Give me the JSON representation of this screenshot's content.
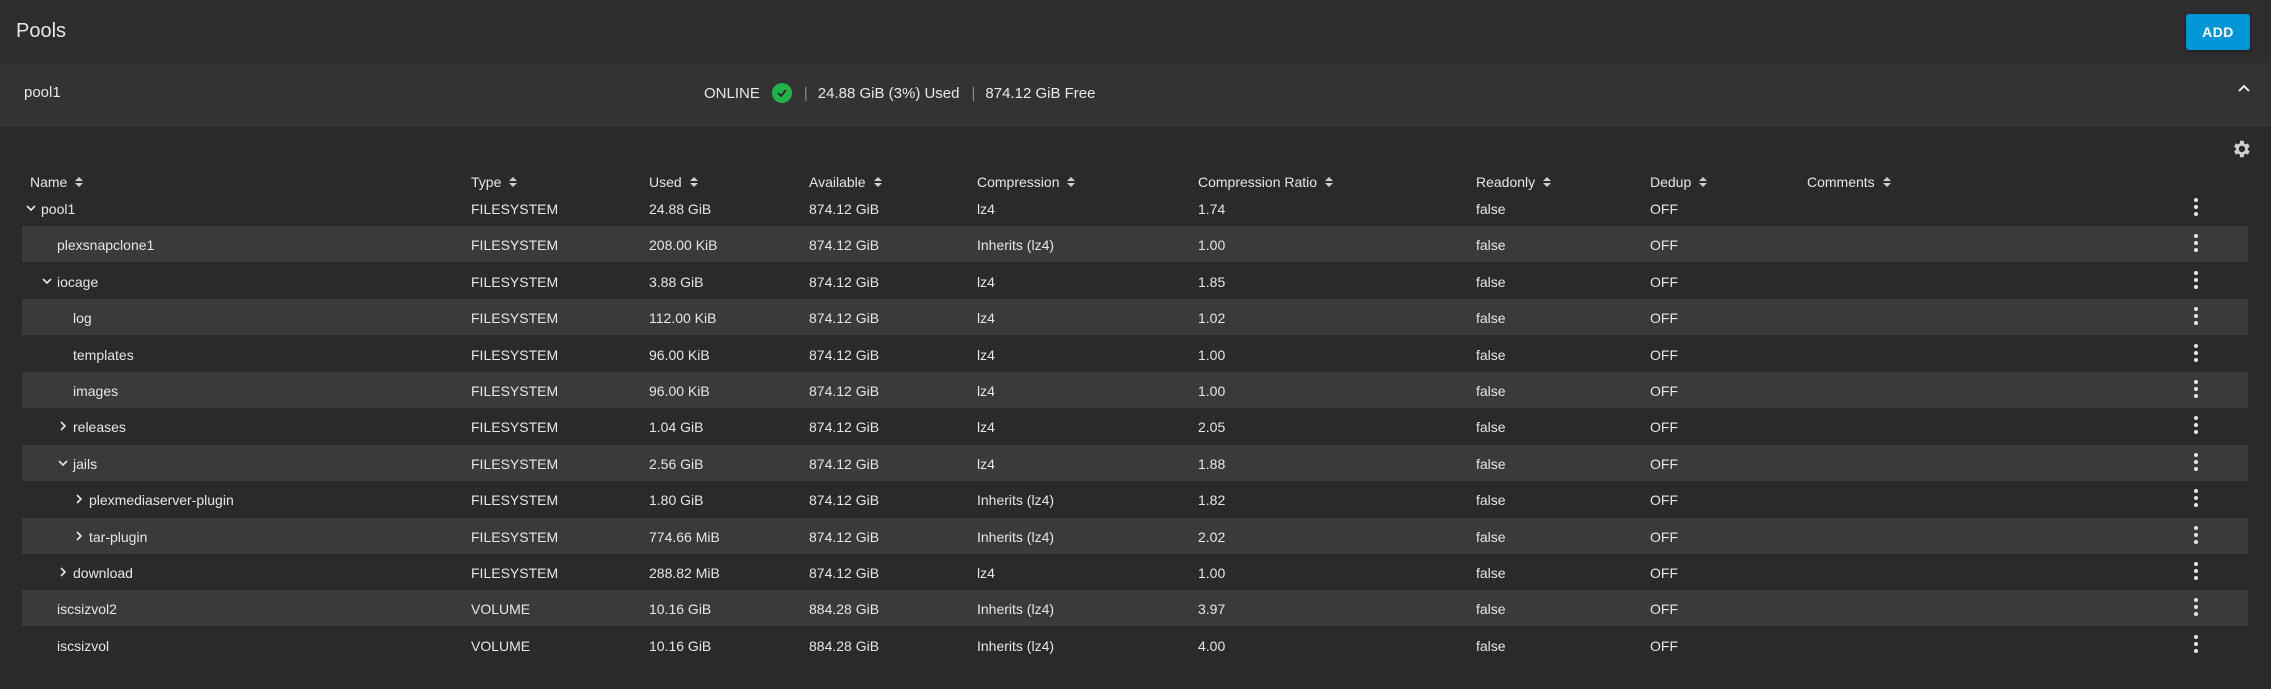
{
  "header": {
    "title": "Pools",
    "add_label": "ADD"
  },
  "pool": {
    "name": "pool1",
    "status": "ONLINE",
    "used": "24.88 GiB (3%) Used",
    "free": "874.12 GiB Free",
    "separator": "|"
  },
  "columns": [
    "Name",
    "Type",
    "Used",
    "Available",
    "Compression",
    "Compression Ratio",
    "Readonly",
    "Dedup",
    "Comments"
  ],
  "rows": [
    {
      "name": "pool1",
      "expander": "expanded",
      "level": 0,
      "type": "FILESYSTEM",
      "used": "24.88 GiB",
      "available": "874.12 GiB",
      "compression": "lz4",
      "ratio": "1.74",
      "readonly": "false",
      "dedup": "OFF",
      "comments": ""
    },
    {
      "name": "plexsnapclone1",
      "expander": "none",
      "level": 1,
      "type": "FILESYSTEM",
      "used": "208.00 KiB",
      "available": "874.12 GiB",
      "compression": "Inherits (lz4)",
      "ratio": "1.00",
      "readonly": "false",
      "dedup": "OFF",
      "comments": ""
    },
    {
      "name": "iocage",
      "expander": "expanded",
      "level": 1,
      "type": "FILESYSTEM",
      "used": "3.88 GiB",
      "available": "874.12 GiB",
      "compression": "lz4",
      "ratio": "1.85",
      "readonly": "false",
      "dedup": "OFF",
      "comments": ""
    },
    {
      "name": "log",
      "expander": "none",
      "level": 2,
      "type": "FILESYSTEM",
      "used": "112.00 KiB",
      "available": "874.12 GiB",
      "compression": "lz4",
      "ratio": "1.02",
      "readonly": "false",
      "dedup": "OFF",
      "comments": ""
    },
    {
      "name": "templates",
      "expander": "none",
      "level": 2,
      "type": "FILESYSTEM",
      "used": "96.00 KiB",
      "available": "874.12 GiB",
      "compression": "lz4",
      "ratio": "1.00",
      "readonly": "false",
      "dedup": "OFF",
      "comments": ""
    },
    {
      "name": "images",
      "expander": "none",
      "level": 2,
      "type": "FILESYSTEM",
      "used": "96.00 KiB",
      "available": "874.12 GiB",
      "compression": "lz4",
      "ratio": "1.00",
      "readonly": "false",
      "dedup": "OFF",
      "comments": ""
    },
    {
      "name": "releases",
      "expander": "collapsed",
      "level": 2,
      "type": "FILESYSTEM",
      "used": "1.04 GiB",
      "available": "874.12 GiB",
      "compression": "lz4",
      "ratio": "2.05",
      "readonly": "false",
      "dedup": "OFF",
      "comments": ""
    },
    {
      "name": "jails",
      "expander": "expanded",
      "level": 2,
      "type": "FILESYSTEM",
      "used": "2.56 GiB",
      "available": "874.12 GiB",
      "compression": "lz4",
      "ratio": "1.88",
      "readonly": "false",
      "dedup": "OFF",
      "comments": ""
    },
    {
      "name": "plexmediaserver-plugin",
      "expander": "collapsed",
      "level": 3,
      "type": "FILESYSTEM",
      "used": "1.80 GiB",
      "available": "874.12 GiB",
      "compression": "Inherits (lz4)",
      "ratio": "1.82",
      "readonly": "false",
      "dedup": "OFF",
      "comments": ""
    },
    {
      "name": "tar-plugin",
      "expander": "collapsed",
      "level": 3,
      "type": "FILESYSTEM",
      "used": "774.66 MiB",
      "available": "874.12 GiB",
      "compression": "Inherits (lz4)",
      "ratio": "2.02",
      "readonly": "false",
      "dedup": "OFF",
      "comments": ""
    },
    {
      "name": "download",
      "expander": "collapsed",
      "level": 2,
      "type": "FILESYSTEM",
      "used": "288.82 MiB",
      "available": "874.12 GiB",
      "compression": "lz4",
      "ratio": "1.00",
      "readonly": "false",
      "dedup": "OFF",
      "comments": ""
    },
    {
      "name": "iscsizvol2",
      "expander": "none",
      "level": 1,
      "type": "VOLUME",
      "used": "10.16 GiB",
      "available": "884.28 GiB",
      "compression": "Inherits (lz4)",
      "ratio": "3.97",
      "readonly": "false",
      "dedup": "OFF",
      "comments": ""
    },
    {
      "name": "iscsizvol",
      "expander": "none",
      "level": 1,
      "type": "VOLUME",
      "used": "10.16 GiB",
      "available": "884.28 GiB",
      "compression": "Inherits (lz4)",
      "ratio": "4.00",
      "readonly": "false",
      "dedup": "OFF",
      "comments": ""
    }
  ],
  "icons": {
    "status": "check-circle-icon",
    "collapse": "chevron-up-icon",
    "settings": "gear-icon",
    "sort": "sort-icon",
    "row_menu": "more-vert-icon"
  },
  "colors": {
    "accent": "#0095d5",
    "online": "#21b349"
  }
}
